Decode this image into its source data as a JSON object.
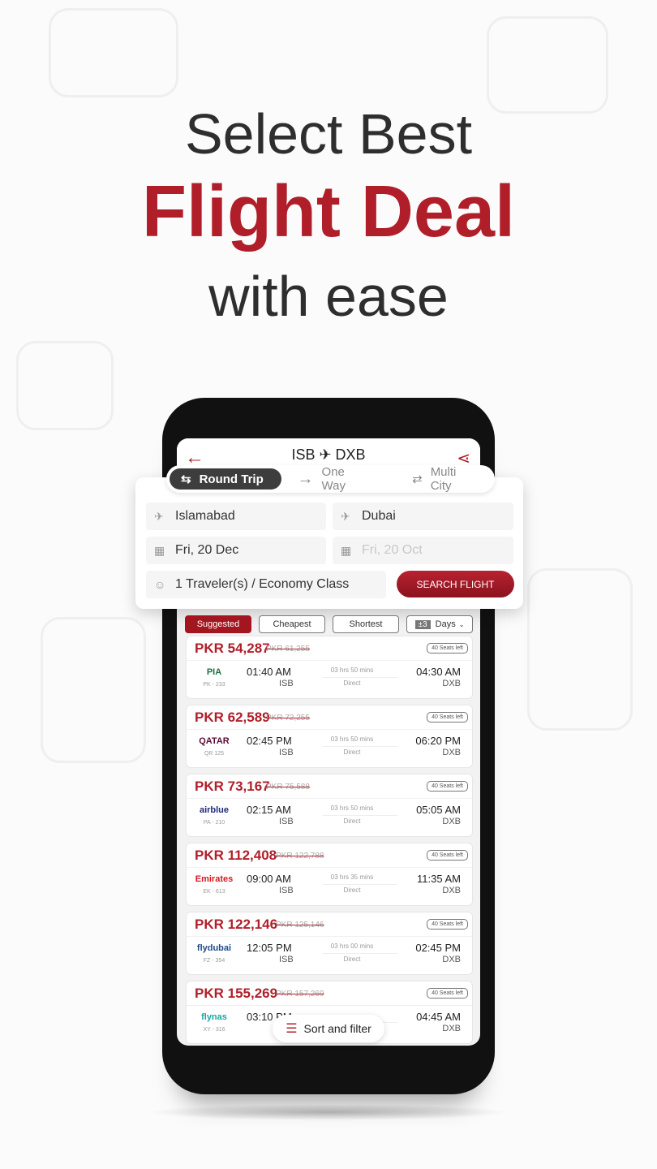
{
  "headline": {
    "line1": "Select Best",
    "line2": "Flight Deal",
    "line3": "with ease"
  },
  "colors": {
    "brand": "#b01e2a",
    "dark": "#3d3d3d"
  },
  "header": {
    "route": "ISB ✈ DXB",
    "back_icon": "←",
    "share_icon": "share-icon"
  },
  "trip_types": [
    {
      "label": "Round Trip",
      "icon": "⇆",
      "active": true
    },
    {
      "label": "One Way",
      "icon": "→"
    },
    {
      "label": "Multi City",
      "icon": "⇄"
    }
  ],
  "search": {
    "from": "Islamabad",
    "to": "Dubai",
    "depart": "Fri, 20 Dec",
    "return": "Fri, 20 Oct",
    "travelers": "1 Traveler(s) / Economy Class",
    "button": "SEARCH FLIGHT"
  },
  "filters": {
    "suggested": "Suggested",
    "cheapest": "Cheapest",
    "shortest": "Shortest",
    "range": "±3",
    "days": "Days"
  },
  "flights": [
    {
      "price": "PKR 54,287",
      "old": "PKR 61,255",
      "seats": "40 Seats left",
      "airline": "PIA",
      "logo_color": "#1f6e43",
      "code": "PK - 233",
      "dep": "01:40 AM",
      "from": "ISB",
      "duration": "03 hrs 50 mins",
      "stops": "Direct",
      "arr": "04:30 AM",
      "to": "DXB"
    },
    {
      "price": "PKR 62,589",
      "old": "PKR 72,255",
      "seats": "40 Seats left",
      "airline": "QATAR",
      "logo_color": "#5c0d35",
      "code": "QR 125",
      "dep": "02:45 PM",
      "from": "ISB",
      "duration": "03 hrs 50 mins",
      "stops": "Direct",
      "arr": "06:20 PM",
      "to": "DXB"
    },
    {
      "price": "PKR 73,167",
      "old": "PKR 75,588",
      "seats": "40 Seats left",
      "airline": "airblue",
      "logo_color": "#1d2a7a",
      "code": "PA - 210",
      "dep": "02:15 AM",
      "from": "ISB",
      "duration": "03 hrs 50 mins",
      "stops": "Direct",
      "arr": "05:05 AM",
      "to": "DXB"
    },
    {
      "price": "PKR 112,408",
      "old": "PKR 122,788",
      "seats": "40 Seats left",
      "airline": "Emirates",
      "logo_color": "#d71921",
      "code": "EK - 613",
      "dep": "09:00 AM",
      "from": "ISB",
      "duration": "03 hrs 35 mins",
      "stops": "Direct",
      "arr": "11:35 AM",
      "to": "DXB"
    },
    {
      "price": "PKR 122,146",
      "old": "PKR 125,146",
      "seats": "40 Seats left",
      "airline": "flydubai",
      "logo_color": "#1e4a8c",
      "code": "FZ - 354",
      "dep": "12:05 PM",
      "from": "ISB",
      "duration": "03 hrs 00 mins",
      "stops": "Direct",
      "arr": "02:45 PM",
      "to": "DXB"
    },
    {
      "price": "PKR 155,269",
      "old": "PKR 157,269",
      "seats": "40 Seats left",
      "airline": "flynas",
      "logo_color": "#1aa5a5",
      "code": "XY - 316",
      "dep": "03:10 PM",
      "from": "ISB",
      "duration": "",
      "stops": "",
      "arr": "04:45 AM",
      "to": "DXB"
    }
  ],
  "sort_filter": "Sort and filter"
}
